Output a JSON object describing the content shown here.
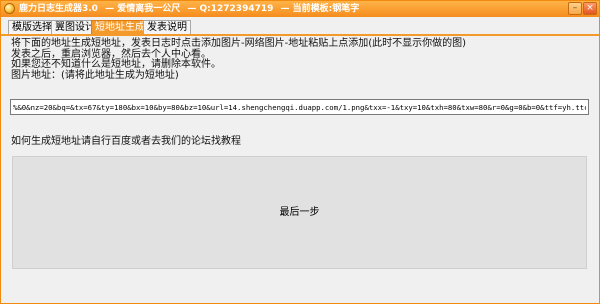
{
  "window": {
    "title_parts": [
      "鹿力日志生成器3.0",
      "—  爱情离我一公尺",
      "— Q:1272394719",
      "— 当前模板:钢笔字"
    ],
    "minimize_label": "–",
    "close_label": "×"
  },
  "tabs": [
    {
      "label": "模版选择",
      "active": false
    },
    {
      "label": "翼图设计",
      "active": false
    },
    {
      "label": "短地址生成",
      "active": true
    },
    {
      "label": "发表说明",
      "active": false
    }
  ],
  "instructions": [
    "将下面的地址生成短地址，发表日志时点击添加图片-网络图片-地址粘贴上点添加(此时不显示你做的图)",
    "发表之后，重启浏览器，然后去个人中心看。",
    "如果您还不知道什么是短地址，请删除本软件。",
    "图片地址：(请将此地址生成为短地址)"
  ],
  "url_field": {
    "value": "%&0&nz=20&bq=&tx=67&ty=180&bx=10&by=80&bz=10&url=14.shengchengqi.duapp.com/1.png&txx=-1&txy=10&txh=80&txw=80&r=0&g=0&b=0&ttf=yh.ttc"
  },
  "help_text": "如何生成短地址请自行百度或者去我们的论坛找教程",
  "final_button": {
    "label": "最后一步"
  },
  "colors": {
    "accent": "#f39a2a",
    "title_bar": "#f58c1e"
  }
}
